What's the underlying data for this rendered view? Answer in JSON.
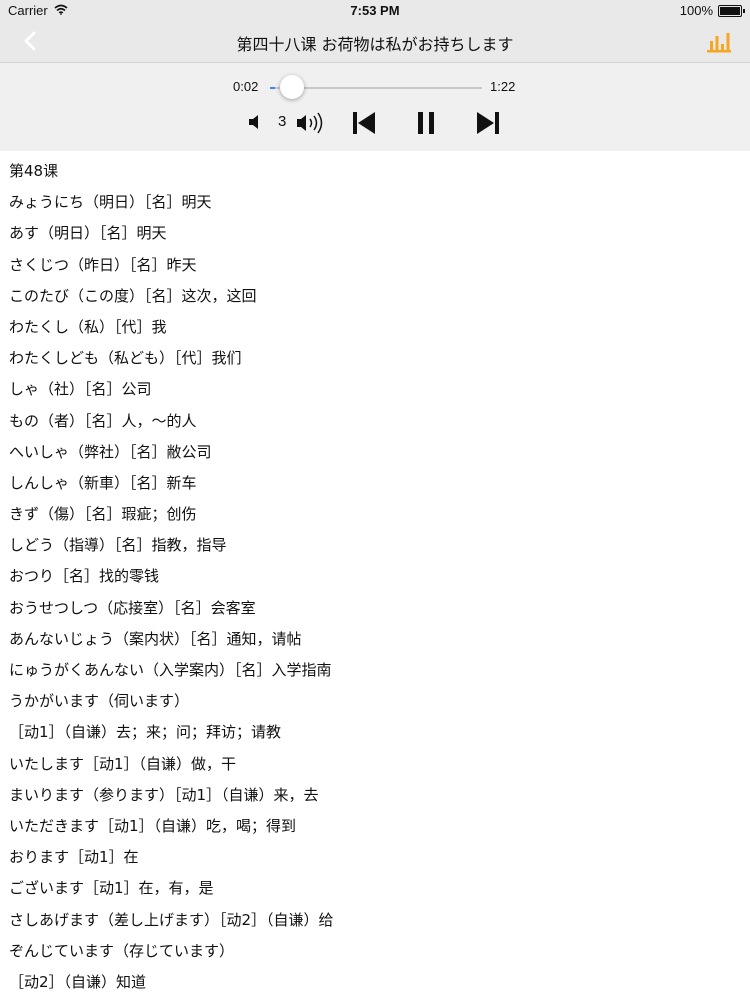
{
  "status_bar": {
    "carrier": "Carrier",
    "time": "7:53 PM",
    "battery": "100%",
    "battery_level": 1.0
  },
  "nav": {
    "title": "第四十八课 お荷物は私がお持ちします",
    "back_icon": "chevron-left-icon",
    "stats_icon": "bar-chart-icon",
    "accent_color": "#f5a623"
  },
  "player": {
    "current_time": "0:02",
    "total_time": "1:22",
    "progress": 0.024,
    "volume": "3",
    "track_color": "#c8c8cc",
    "fill_color": "#3a86ff"
  },
  "content": {
    "lines": [
      "第48课",
      "みょうにち（明日）［名］明天",
      "あす（明日）［名］明天",
      "さくじつ（昨日）［名］昨天",
      "このたび（この度）［名］这次，这回",
      "わたくし（私）［代］我",
      "わたくしども（私ども）［代］我们",
      "しゃ（社）［名］公司",
      "もの（者）［名］人，～的人",
      "へいしゃ（弊社）［名］敝公司",
      "しんしゃ（新車）［名］新车",
      "きず（傷）［名］瑕疵；创伤",
      "しどう（指導）［名］指教，指导",
      "おつり［名］找的零钱",
      "おうせつしつ（応接室）［名］会客室",
      "あんないじょう（案内状）［名］通知，请帖",
      "にゅうがくあんない（入学案内）［名］入学指南",
      "うかがいます（伺います）",
      "［动1］（自谦）去；来；问；拜访；请教",
      "いたします［动1］（自谦）做，干",
      "まいります（参ります）［动1］（自谦）来，去",
      "いただきます［动1］（自谦）吃，喝；得到",
      "おります［动1］在",
      "ございます［动1］在，有，是",
      "さしあげます（差し上げます）［动2］（自谦）给",
      "ぞんじています（存じています）",
      "［动2］（自谦）知道"
    ]
  }
}
